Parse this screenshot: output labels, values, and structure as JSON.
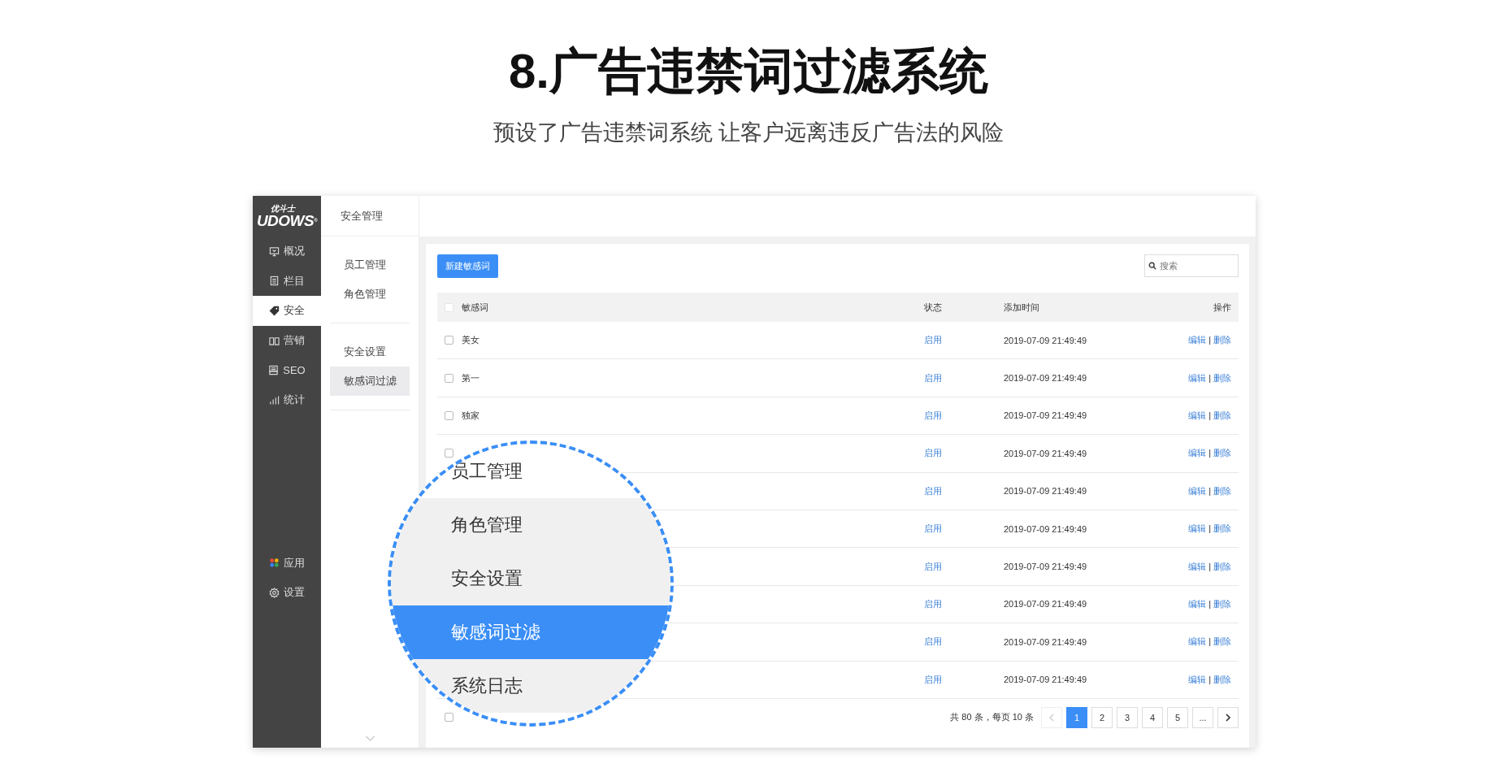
{
  "title": "8.广告违禁词过滤系统",
  "subtitle": "预设了广告违禁词系统 让客户远离违反广告法的风险",
  "logo": {
    "tagline": "优斗士",
    "wordmark": "UDOWS",
    "mark": "®"
  },
  "sidebar": {
    "items": [
      {
        "label": "概况",
        "selected": false
      },
      {
        "label": "栏目",
        "selected": false
      },
      {
        "label": "安全",
        "selected": true
      },
      {
        "label": "营销",
        "selected": false
      },
      {
        "label": "SEO",
        "selected": false
      },
      {
        "label": "统计",
        "selected": false
      }
    ],
    "bottom_items": [
      {
        "label": "应用"
      },
      {
        "label": "设置"
      }
    ]
  },
  "subnav": {
    "title": "安全管理",
    "groups": [
      [
        {
          "label": "员工管理",
          "selected": false
        },
        {
          "label": "角色管理",
          "selected": false
        }
      ],
      [
        {
          "label": "安全设置",
          "selected": false
        },
        {
          "label": "敏感词过滤",
          "selected": true
        }
      ]
    ]
  },
  "toolbar": {
    "new_button": "新建敏感词",
    "search": {
      "placeholder": "搜索"
    }
  },
  "table": {
    "columns": [
      "敏感词",
      "状态",
      "添加时间",
      "操作"
    ],
    "header_checked": false,
    "rows": [
      {
        "word": "美女",
        "checked": false,
        "status": "启用",
        "time": "2019-07-09 21:49:49",
        "actions": [
          "编辑",
          "删除"
        ]
      },
      {
        "word": "第一",
        "checked": false,
        "status": "启用",
        "time": "2019-07-09 21:49:49",
        "actions": [
          "编辑",
          "删除"
        ]
      },
      {
        "word": "独家",
        "checked": false,
        "status": "启用",
        "time": "2019-07-09 21:49:49",
        "actions": [
          "编辑",
          "删除"
        ]
      },
      {
        "checked": false,
        "status": "启用",
        "time": "2019-07-09 21:49:49",
        "actions": [
          "编辑",
          "删除"
        ]
      },
      {
        "status": "启用",
        "time": "2019-07-09 21:49:49",
        "actions": [
          "编辑",
          "删除"
        ]
      },
      {
        "status": "启用",
        "time": "2019-07-09 21:49:49",
        "actions": [
          "编辑",
          "删除"
        ]
      },
      {
        "status": "启用",
        "time": "2019-07-09 21:49:49",
        "actions": [
          "编辑",
          "删除"
        ]
      },
      {
        "status": "启用",
        "time": "2019-07-09 21:49:49",
        "actions": [
          "编辑",
          "删除"
        ]
      },
      {
        "status": "启用",
        "time": "2019-07-09 21:49:49",
        "actions": [
          "编辑",
          "删除"
        ]
      },
      {
        "status": "启用",
        "time": "2019-07-09 21:49:49",
        "actions": [
          "编辑",
          "删除"
        ]
      }
    ],
    "action_separator": "|",
    "footer_checked": false
  },
  "pagination": {
    "summary": "共 80 条，每页 10 条",
    "prev": {
      "disabled": true
    },
    "pages": [
      {
        "label": "1",
        "selected": true
      },
      {
        "label": "2",
        "selected": false
      },
      {
        "label": "3",
        "selected": false
      },
      {
        "label": "4",
        "selected": false
      },
      {
        "label": "5",
        "selected": false
      },
      {
        "label": "...",
        "selected": false
      }
    ],
    "next": {
      "disabled": false
    }
  },
  "magnifier": {
    "items": [
      {
        "label": "员工管理",
        "shaded": false,
        "selected": false
      },
      {
        "label": "角色管理",
        "shaded": true,
        "selected": false
      },
      {
        "label": "安全设置",
        "shaded": true,
        "selected": false
      },
      {
        "label": "敏感词过滤",
        "shaded": true,
        "selected": true
      },
      {
        "label": "系统日志",
        "shaded": true,
        "selected": false
      }
    ]
  }
}
